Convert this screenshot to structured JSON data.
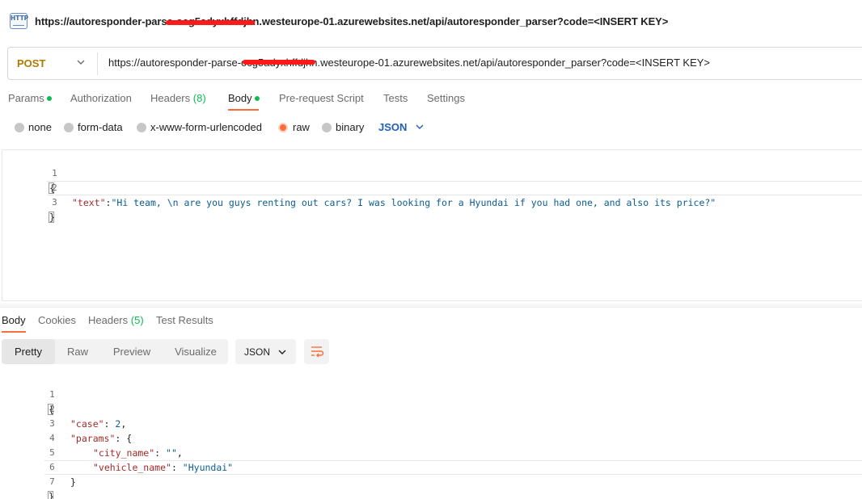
{
  "title": {
    "icon": "http-icon",
    "icon_label": "HTTP",
    "url": "https://autoresponder-parse-ocg5adyxhffdjhn.westeurope-01.azurewebsites.net/api/autoresponder_parser?code=<INSERT KEY>"
  },
  "request": {
    "method": "POST",
    "url": "https://autoresponder-parse-ocg5adyxhffdjhn.westeurope-01.azurewebsites.net/api/autoresponder_parser?code=<INSERT KEY>"
  },
  "tabs": {
    "params": "Params",
    "authorization": "Authorization",
    "headers": "Headers",
    "headers_count": "(8)",
    "body": "Body",
    "prerequest": "Pre-request Script",
    "tests": "Tests",
    "settings": "Settings"
  },
  "body_types": {
    "none": "none",
    "form_data": "form-data",
    "urlencoded": "x-www-form-urlencoded",
    "raw": "raw",
    "binary": "binary",
    "format": "JSON"
  },
  "request_body": {
    "line_numbers": [
      "1",
      "2",
      "3"
    ],
    "open": "{",
    "key": "\"text\"",
    "colon": ":",
    "value": "\"Hi team, \\n are you guys renting out cars? I was looking for a Hyundai if you had one, and also its price?\"",
    "close": "}"
  },
  "response_tabs": {
    "body": "Body",
    "cookies": "Cookies",
    "headers": "Headers",
    "headers_count": "(5)",
    "test_results": "Test Results"
  },
  "view_modes": {
    "pretty": "Pretty",
    "raw": "Raw",
    "preview": "Preview",
    "visualize": "Visualize",
    "format": "JSON"
  },
  "response_body": {
    "line_numbers": [
      "1",
      "2",
      "3",
      "4",
      "5",
      "6",
      "7"
    ],
    "open": "{",
    "case_key": "\"case\"",
    "case_value": "2",
    "params_key": "\"params\"",
    "params_open": "{",
    "city_key": "\"city_name\"",
    "city_value": "\"\"",
    "vehicle_key": "\"vehicle_name\"",
    "vehicle_value": "\"Hyundai\"",
    "params_close": "}",
    "close": "}"
  },
  "colors": {
    "method": "#ad7a03",
    "accent": "#ff6c37",
    "success": "#0cbb52",
    "link": "#1f5fbd"
  }
}
